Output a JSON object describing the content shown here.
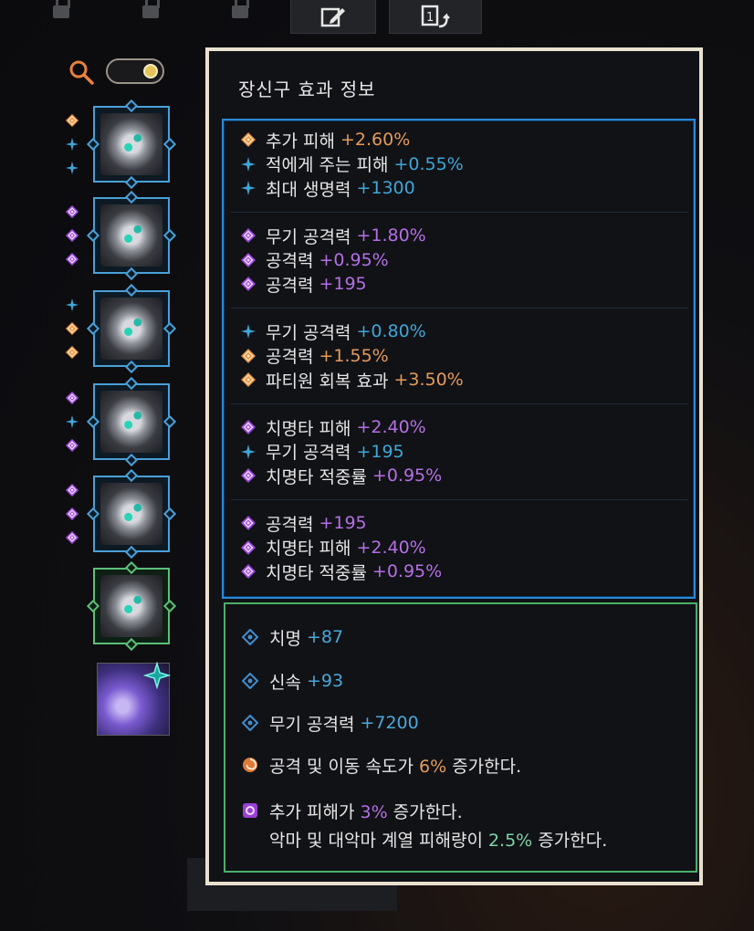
{
  "panel": {
    "title": "장신구 효과 정보",
    "groups": [
      {
        "lines": [
          {
            "icon": "orange",
            "label": "추가 피해",
            "value": "+2.60%"
          },
          {
            "icon": "blue",
            "label": "적에게 주는 피해",
            "value": "+0.55%"
          },
          {
            "icon": "blue",
            "label": "최대 생명력",
            "value": "+1300"
          }
        ]
      },
      {
        "lines": [
          {
            "icon": "purple",
            "label": "무기 공격력",
            "value": "+1.80%"
          },
          {
            "icon": "purple",
            "label": "공격력",
            "value": "+0.95%"
          },
          {
            "icon": "purple",
            "label": "공격력",
            "value": "+195"
          }
        ]
      },
      {
        "lines": [
          {
            "icon": "blue",
            "label": "무기 공격력",
            "value": "+0.80%"
          },
          {
            "icon": "orange",
            "label": "공격력",
            "value": "+1.55%"
          },
          {
            "icon": "orange",
            "label": "파티원 회복 효과",
            "value": "+3.50%"
          }
        ]
      },
      {
        "lines": [
          {
            "icon": "purple",
            "label": "치명타 피해",
            "value": "+2.40%"
          },
          {
            "icon": "blue",
            "label": "무기 공격력",
            "value": "+195"
          },
          {
            "icon": "purple",
            "label": "치명타 적중률",
            "value": "+0.95%"
          }
        ]
      },
      {
        "lines": [
          {
            "icon": "purple",
            "label": "공격력",
            "value": "+195"
          },
          {
            "icon": "purple",
            "label": "치명타 피해",
            "value": "+2.40%"
          },
          {
            "icon": "purple",
            "label": "치명타 적중률",
            "value": "+0.95%"
          }
        ]
      }
    ],
    "stats": [
      {
        "label": "치명",
        "value": "+87"
      },
      {
        "label": "신속",
        "value": "+93"
      },
      {
        "label": "무기 공격력",
        "value": "+7200"
      }
    ],
    "effects": [
      {
        "icon": "orange-swirl-icon",
        "before": "공격 및 이동 속도가 ",
        "pct": "6%",
        "after": " 증가한다."
      },
      {
        "icon": "purple-square-icon",
        "before": "추가 피해가 ",
        "pct": "3%",
        "after": " 증가한다.",
        "line2_before": "악마 및 대악마 계열 피해량이 ",
        "line2_pct": "2.5%",
        "line2_after": " 증가한다."
      }
    ]
  },
  "colors": {
    "orange": "#e59b5a",
    "blue": "#3fa6d8",
    "purple": "#b46fe4",
    "panel_border": "#e9e1cf",
    "blue_section": "#2a8ad8",
    "green_section": "#49b06a"
  },
  "left": {
    "search_icon": "search-icon",
    "toggle_on": true,
    "slots": [
      {
        "type": "necklace",
        "markers": [
          "orange",
          "blue",
          "blue"
        ]
      },
      {
        "type": "earring",
        "markers": [
          "purple",
          "purple",
          "purple"
        ]
      },
      {
        "type": "earring",
        "markers": [
          "blue",
          "orange",
          "orange"
        ]
      },
      {
        "type": "ring",
        "markers": [
          "purple",
          "blue",
          "purple"
        ]
      },
      {
        "type": "ring",
        "markers": [
          "purple",
          "purple",
          "purple"
        ]
      },
      {
        "type": "bracelet",
        "markers": []
      },
      {
        "type": "ability-stone",
        "markers": []
      }
    ]
  }
}
